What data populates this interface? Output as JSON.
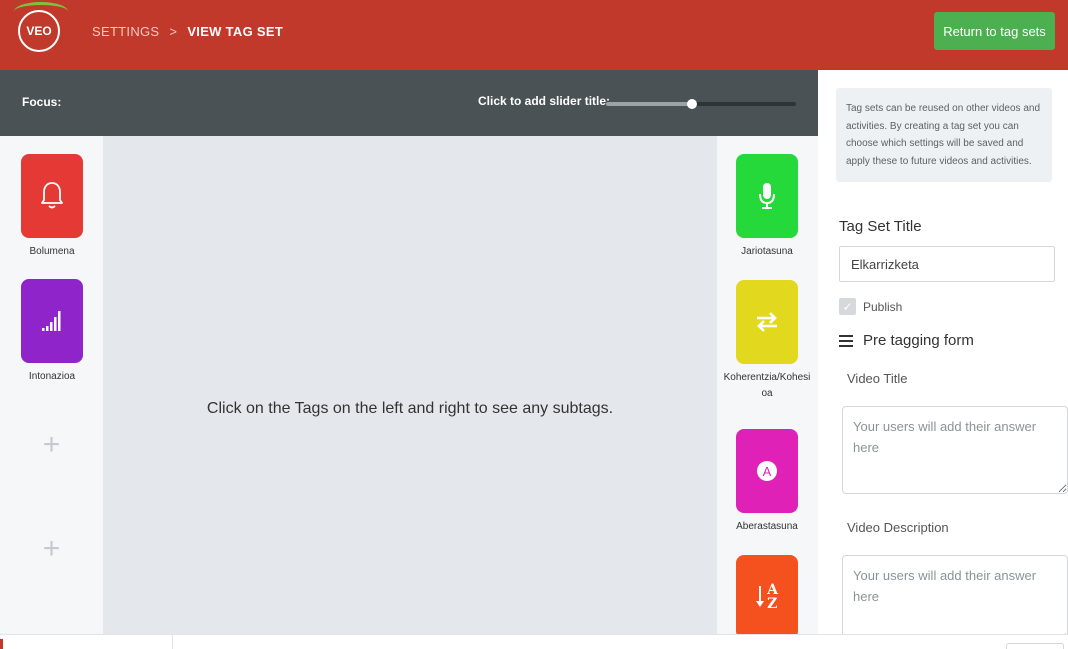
{
  "app": {
    "logo_text": "VEO",
    "breadcrumb": [
      "SETTINGS",
      "VIEW TAG SET"
    ],
    "breadcrumb_separator": ">",
    "return_button": "Return to tag sets"
  },
  "focus_bar": {
    "focus_label": "Focus:",
    "slider_title_prompt": "Click to add slider title:",
    "slider_value_fraction": 0.45
  },
  "left_tags": [
    {
      "label": "Bolumena",
      "color": "#e53935",
      "icon": "bell-icon"
    },
    {
      "label": "Intonazioa",
      "color": "#8e24c9",
      "icon": "signal-bars-icon"
    }
  ],
  "left_add_slots": [
    "+",
    "+"
  ],
  "right_tags": [
    {
      "label": "Jariotasuna",
      "color": "#25d93a",
      "icon": "microphone-icon"
    },
    {
      "label": "Koherentzia/Kohesioa",
      "color": "#e2d91f",
      "icon": "swap-arrows-icon"
    },
    {
      "label": "Aberastasuna",
      "color": "#e021b8",
      "icon": "letter-a-circle-icon",
      "icon_letter": "A"
    },
    {
      "label": "",
      "color": "#f4511e",
      "icon": "sort-alpha-down-icon",
      "icon_letters": [
        "A",
        "Z"
      ]
    }
  ],
  "center": {
    "message": "Click on the Tags on the left and right to see any subtags."
  },
  "panel": {
    "info_text": "Tag sets can be reused on other videos and activities. By creating a tag set you can choose which settings will be saved and apply these to future videos and activities.",
    "tag_set_title_label": "Tag Set Title",
    "tag_set_title_value": "Elkarrizketa",
    "publish_label": "Publish",
    "publish_checked": true,
    "pretagging_heading": "Pre tagging form",
    "fields": [
      {
        "label": "Video Title",
        "placeholder": "Your users will add their answer here"
      },
      {
        "label": "Video Description",
        "placeholder": "Your users will add their answer here"
      }
    ]
  },
  "colors": {
    "header": "#c0392b",
    "return_button": "#4caf50",
    "focus_bar": "#4a5255",
    "center_bg": "#e4e8ec"
  }
}
